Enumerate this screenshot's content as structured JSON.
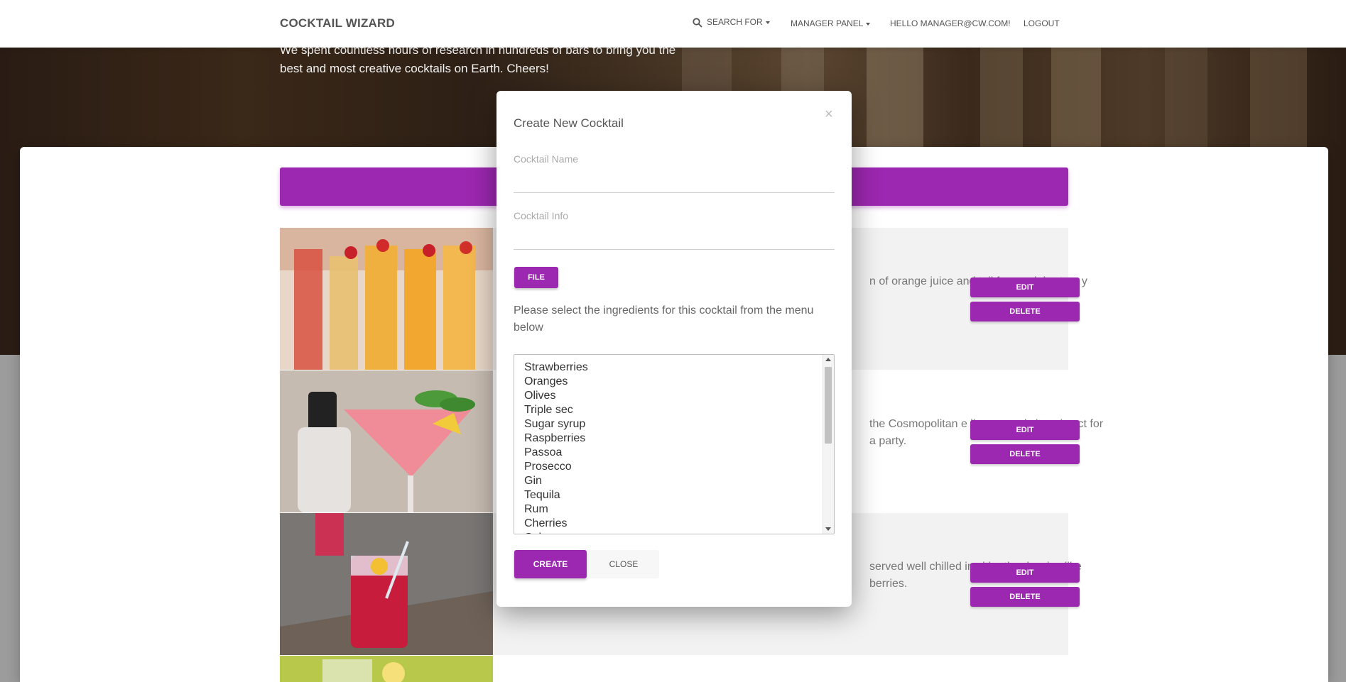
{
  "app": {
    "brand": "COCKTAIL WIZARD"
  },
  "nav": {
    "search_label": "SEARCH FOR",
    "manager_label": "MANAGER PANEL",
    "greeting": "HELLO MANAGER@CW.COM!",
    "logout": "LOGOUT"
  },
  "hero": {
    "text": "We spent countless hours of research in hundreds of bars to bring you the best and most creative cocktails on Earth. Cheers!"
  },
  "rows": [
    {
      "text": "n of orange juice and tail for a celebratory y",
      "edit": "EDIT",
      "delete": "DELETE"
    },
    {
      "text": "the Cosmopolitan e liqueur and citrus is ect for a party.",
      "edit": "EDIT",
      "delete": "DELETE"
    },
    {
      "text": "served well chilled in vith other berries like berries.",
      "edit": "EDIT",
      "delete": "DELETE"
    }
  ],
  "modal": {
    "title": "Create New Cocktail",
    "close_symbol": "×",
    "name_label": "Cocktail Name",
    "name_value": "",
    "info_label": "Cocktail Info",
    "info_value": "",
    "file_button": "FILE",
    "instructions": "Please select the ingredients for this cocktail from the menu below",
    "ingredients": [
      "Strawberries",
      "Oranges",
      "Olives",
      "Triple sec",
      "Sugar syrup",
      "Raspberries",
      "Passoa",
      "Prosecco",
      "Gin",
      "Tequila",
      "Rum",
      "Cherries",
      "Coke"
    ],
    "create_button": "CREATE",
    "close_button": "CLOSE"
  },
  "colors": {
    "accent": "#9c27b0",
    "navbar_bg": "#ffffff"
  }
}
